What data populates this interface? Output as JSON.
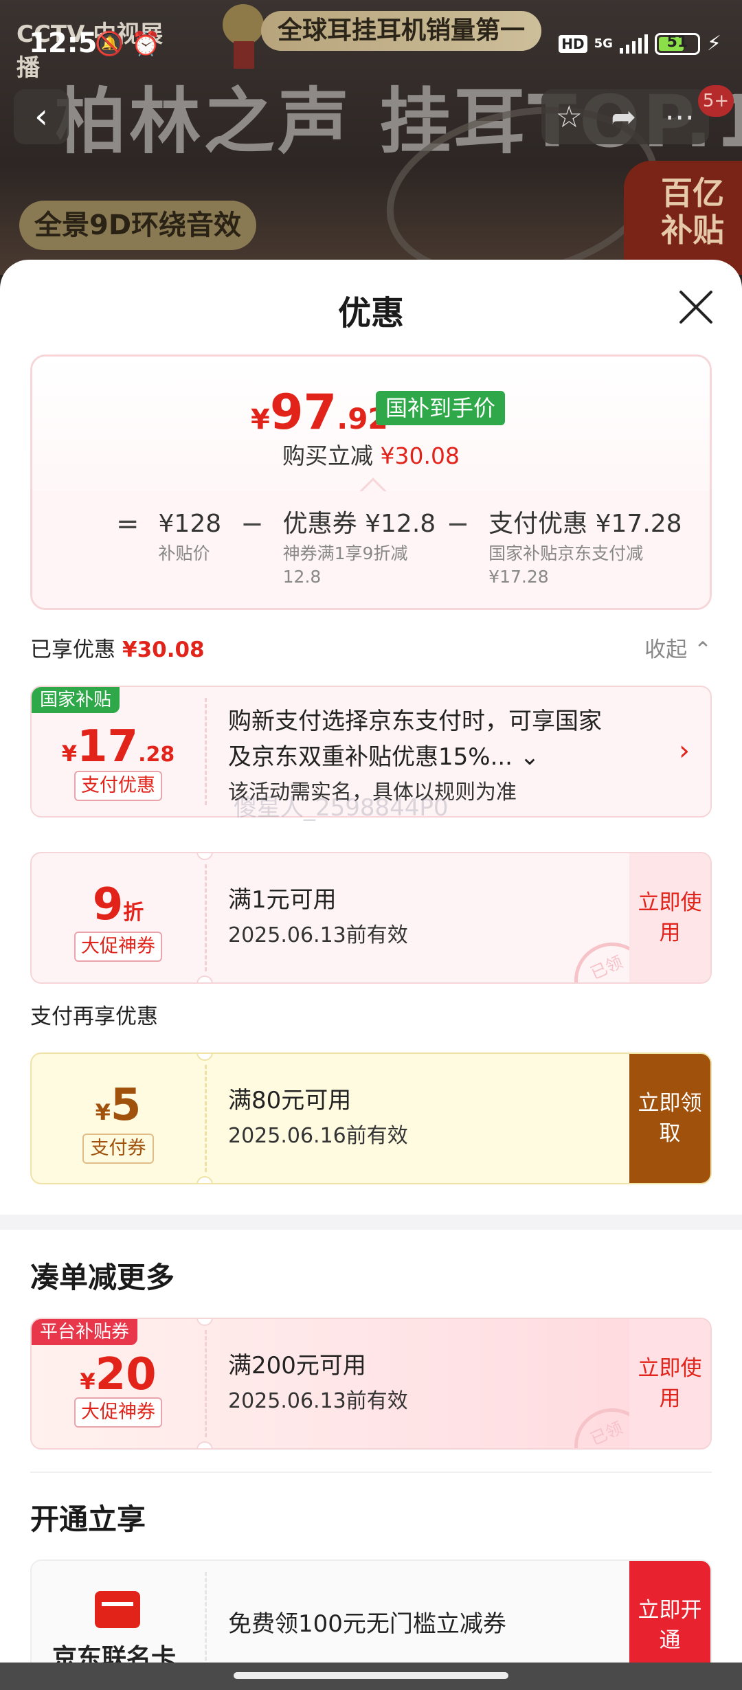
{
  "status_bar": {
    "time": "12:51",
    "hd": "HD",
    "network": "5G",
    "battery": "51"
  },
  "hero": {
    "channel_logo": "CCTV 中视展播",
    "slogan": "全球耳挂耳机销量第一",
    "big_title": "柏林之声 挂耳TOP.1",
    "feature": "全景9D环绕音效",
    "subsidy_badge_line1": "百亿",
    "subsidy_badge_line2": "补贴",
    "notification_count": "5+"
  },
  "sheet": {
    "title": "优惠",
    "summary": {
      "yen": "¥",
      "price_int": "97",
      "price_dec": ".92",
      "price_tag": "国补到手价",
      "buy_minus_label": "购买立减",
      "buy_minus_amount": "¥30.08",
      "eq": "=",
      "minus": "−",
      "base_price": "¥128",
      "base_label": "补贴价",
      "coupon_main": "优惠券 ¥12.8",
      "coupon_sub": "神券满1享9折减12.8",
      "pay_main": "支付优惠 ¥17.28",
      "pay_sub": "国家补贴京东支付减¥17.28"
    },
    "enjoyed_label": "已享优惠",
    "enjoyed_amount": "¥30.08",
    "collapse_label": "收起 ⌃",
    "watermark": "傻星人_2598844P0",
    "national": {
      "tag": "国家补贴",
      "yen": "¥",
      "int": "17",
      "dec": ".28",
      "label": "支付优惠",
      "desc1": "购新支付选择京东支付时，可享国家",
      "desc2": "及京东双重补贴优惠15%... ⌄",
      "desc3": "该活动需实名，具体以规则为准"
    },
    "discount": {
      "big": "9",
      "unit": "折",
      "label": "大促神券",
      "cond": "满1元可用",
      "valid": "2025.06.13前有效",
      "action": "立即使用",
      "stamp": "已领"
    },
    "pay_more_title": "支付再享优惠",
    "pay_coupon": {
      "yen": "¥",
      "big": "5",
      "label": "支付券",
      "cond": "满80元可用",
      "valid": "2025.06.16前有效",
      "action": "立即领取"
    },
    "more_title": "凑单减更多",
    "platform": {
      "tag": "平台补贴券",
      "yen": "¥",
      "big": "20",
      "label": "大促神券",
      "cond": "满200元可用",
      "valid": "2025.06.13前有效",
      "action": "立即使用",
      "stamp": "已领"
    },
    "open_title": "开通立享",
    "unionpay": {
      "name": "京东联名卡",
      "desc": "免费领100元无门槛立减券",
      "action": "立即开通"
    }
  }
}
